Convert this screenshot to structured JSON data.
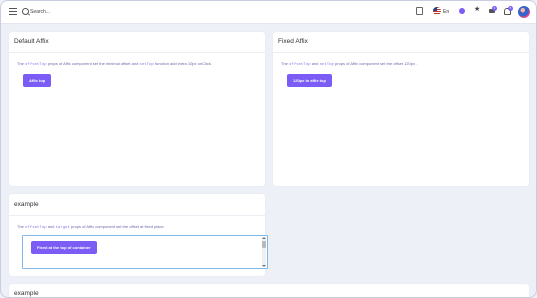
{
  "header": {
    "search_placeholder": "Search...",
    "language": "En",
    "cart_badge": "2",
    "notification_badge": "5"
  },
  "cards": {
    "default_affix": {
      "title": "Default Affix",
      "desc_before": "The ",
      "desc_code1": "offsetTop",
      "desc_middle": " props of Affix component set the minimal offset and ",
      "desc_code2": "setTop",
      "desc_after": " function add extra 10px onClick.",
      "button_label": "Affix top"
    },
    "fixed_affix": {
      "title": "Fixed Affix",
      "desc_before": "The ",
      "desc_code1": "offsetTop",
      "desc_middle": " and ",
      "desc_code2": "setTop",
      "desc_after": " props of Affix component set the offset 120px .",
      "button_label": "120px to affix top"
    },
    "example": {
      "title": "example",
      "desc_before": "The ",
      "desc_code1": "offsetTop",
      "desc_middle": " and ",
      "desc_code2": "target",
      "desc_after": " props of Affix component set the offset at fixed place.",
      "button_label": "Fixed at the top of container"
    },
    "example2": {
      "title": "example"
    }
  },
  "colors": {
    "accent": "#7b5cf5",
    "background": "#eef0f8",
    "card": "#ffffff"
  },
  "icons": [
    "menu-icon",
    "search-icon",
    "calculator-icon",
    "us-flag-icon",
    "theme-icon",
    "star-icon",
    "cart-icon",
    "bell-icon"
  ]
}
